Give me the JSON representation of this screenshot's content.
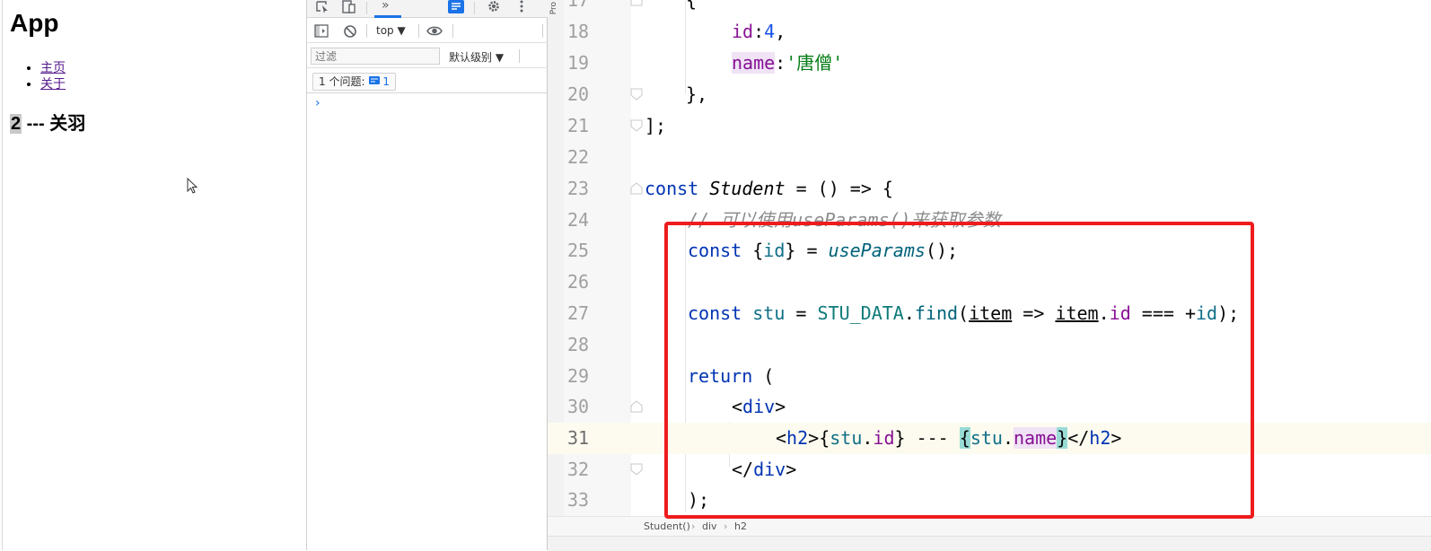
{
  "browser": {
    "app_title": "App",
    "nav": [
      {
        "label": "主页"
      },
      {
        "label": "关于"
      }
    ],
    "student_heading": {
      "id": "2",
      "separator": " --- ",
      "name": "关羽"
    }
  },
  "devtools": {
    "more_tabs_label": "»",
    "context": "top ▼",
    "filter_placeholder": "过滤",
    "level_label": "默认级别 ▼",
    "issues_label": "1 个问题:",
    "issues_count": "1",
    "prompt": "›"
  },
  "editor": {
    "project_tab_label": "Pro",
    "breadcrumbs": [
      "Student()",
      "div",
      "h2"
    ],
    "breadcrumb_separator": "›",
    "lines": [
      {
        "num": "17"
      },
      {
        "num": "18"
      },
      {
        "num": "19"
      },
      {
        "num": "20"
      },
      {
        "num": "21"
      },
      {
        "num": "22"
      },
      {
        "num": "23"
      },
      {
        "num": "24"
      },
      {
        "num": "25"
      },
      {
        "num": "26"
      },
      {
        "num": "27"
      },
      {
        "num": "28"
      },
      {
        "num": "29"
      },
      {
        "num": "30"
      },
      {
        "num": "31"
      },
      {
        "num": "32"
      },
      {
        "num": "33"
      }
    ],
    "tokens": {
      "l17_brace": "{",
      "l18_key": "id",
      "l18_colon": ":",
      "l18_val": "4",
      "l18_comma": ",",
      "l19_key": "name",
      "l19_colon": ":",
      "l19_val": "'唐僧'",
      "l20": "},",
      "l21": "];",
      "l23_const": "const ",
      "l23_name": "Student",
      "l23_rest": " = () => {",
      "l24_comment": "// 可以使用useParams()来获取参数",
      "l25_const": "const ",
      "l25_open": "{",
      "l25_id": "id",
      "l25_close": "} = ",
      "l25_fn": "useParams",
      "l25_end": "();",
      "l27_const": "const ",
      "l27_stu": "stu",
      "l27_eq": " = ",
      "l27_data": "STU_DATA",
      "l27_dot": ".",
      "l27_find": "find",
      "l27_paren": "(",
      "l27_item": "item",
      "l27_arrow": " => ",
      "l27_item2": "item",
      "l27_dot2": ".",
      "l27_id": "id",
      "l27_cmp": " === +",
      "l27_id2": "id",
      "l27_end": ");",
      "l29_return": "return",
      "l29_paren": " (",
      "l30_open": "<",
      "l30_tag": "div",
      "l30_close": ">",
      "l31_open": "<",
      "l31_tag": "h2",
      "l31_close": ">",
      "l31_b1": "{",
      "l31_stu": "stu",
      "l31_dot": ".",
      "l31_id": "id",
      "l31_b2": "}",
      "l31_sep": " --- ",
      "l31_b3": "{",
      "l31_stu2": "stu",
      "l31_dot2": ".",
      "l31_name": "name",
      "l31_b4": "}",
      "l31_end_open": "</",
      "l31_end_tag": "h2",
      "l31_end_close": ">",
      "l32_open": "</",
      "l32_tag": "div",
      "l32_close": ">",
      "l33": ");"
    }
  },
  "colors": {
    "highlight_border": "#ee1c1c",
    "keyword": "#0033b3",
    "string": "#067d17",
    "property": "#871094"
  }
}
